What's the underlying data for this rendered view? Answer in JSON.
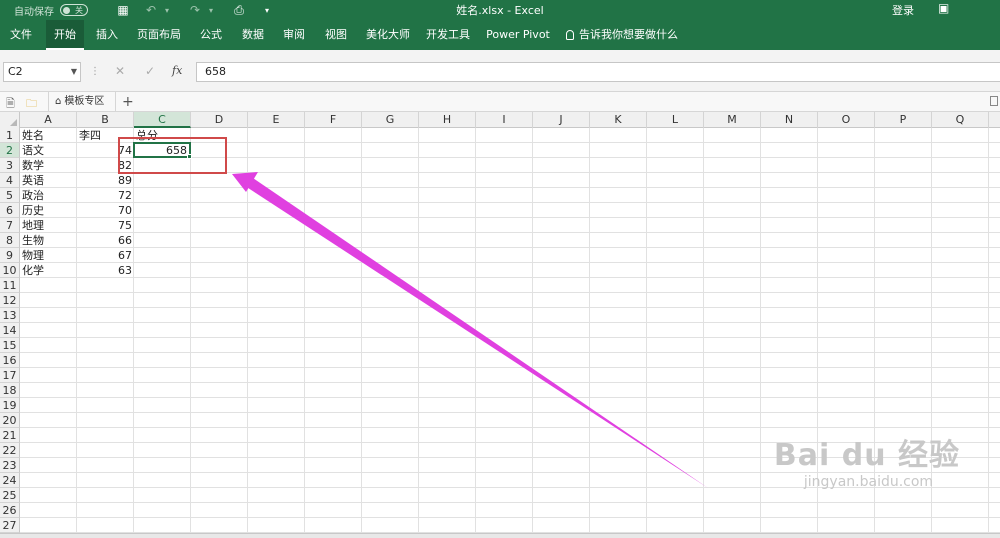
{
  "titlebar": {
    "autosave_label": "自动保存",
    "autosave_state": "关",
    "title": "姓名.xlsx  -  Excel",
    "login": "登录",
    "accent": "#217346"
  },
  "ribbon": {
    "tabs": [
      "文件",
      "开始",
      "插入",
      "页面布局",
      "公式",
      "数据",
      "审阅",
      "视图",
      "美化大师",
      "开发工具",
      "Power Pivot"
    ],
    "active_tab": "开始",
    "tell_me": "告诉我你想要做什么"
  },
  "formula_bar": {
    "name_box": "C2",
    "fx_label": "fx",
    "formula": "658"
  },
  "sheet_tabs": {
    "template_tab": "模板专区",
    "add_label": "+"
  },
  "grid": {
    "columns": [
      "A",
      "B",
      "C",
      "D",
      "E",
      "F",
      "G",
      "H",
      "I",
      "J",
      "K",
      "L",
      "M",
      "N",
      "O",
      "P",
      "Q"
    ],
    "rows": [
      "1",
      "2",
      "3",
      "4",
      "5",
      "6",
      "7",
      "8",
      "9",
      "10",
      "11",
      "12",
      "13",
      "14",
      "15",
      "16",
      "17",
      "18",
      "19",
      "20",
      "21",
      "22",
      "23",
      "24",
      "25",
      "26",
      "27"
    ],
    "selected_column": "C",
    "selected_row": "2",
    "header": {
      "a": "姓名",
      "b": "李四",
      "c": "总分"
    },
    "data": [
      {
        "subject": "语文",
        "score": "74"
      },
      {
        "subject": "数学",
        "score": "82"
      },
      {
        "subject": "英语",
        "score": "89"
      },
      {
        "subject": "政治",
        "score": "72"
      },
      {
        "subject": "历史",
        "score": "70"
      },
      {
        "subject": "地理",
        "score": "75"
      },
      {
        "subject": "生物",
        "score": "66"
      },
      {
        "subject": "物理",
        "score": "67"
      },
      {
        "subject": "化学",
        "score": "63"
      }
    ],
    "total": "658"
  },
  "annotation": {
    "box_color": "#d04a4a",
    "arrow_color": "#e040e0"
  },
  "watermark": {
    "brand": "Bai du 经验",
    "url": "jingyan.baidu.com"
  }
}
